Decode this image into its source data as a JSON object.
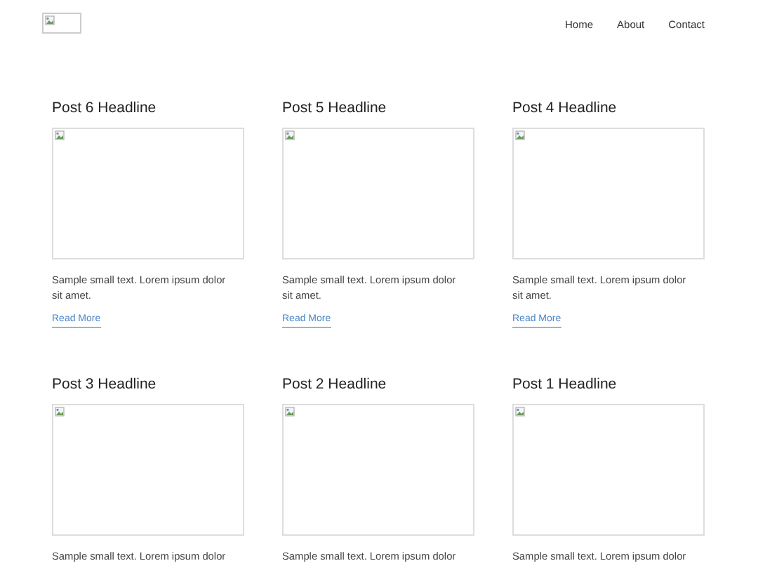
{
  "nav": {
    "items": [
      {
        "label": "Home"
      },
      {
        "label": "About"
      },
      {
        "label": "Contact"
      }
    ]
  },
  "posts": [
    {
      "headline": "Post 6 Headline",
      "text": "Sample small text. Lorem ipsum dolor sit amet.",
      "link": "Read More"
    },
    {
      "headline": "Post 5 Headline",
      "text": "Sample small text. Lorem ipsum dolor sit amet.",
      "link": "Read More"
    },
    {
      "headline": "Post 4 Headline",
      "text": "Sample small text. Lorem ipsum dolor sit amet.",
      "link": "Read More"
    },
    {
      "headline": "Post 3 Headline",
      "text": "Sample small text. Lorem ipsum dolor"
    },
    {
      "headline": "Post 2 Headline",
      "text": "Sample small text. Lorem ipsum dolor"
    },
    {
      "headline": "Post 1 Headline",
      "text": "Sample small text. Lorem ipsum dolor"
    }
  ]
}
